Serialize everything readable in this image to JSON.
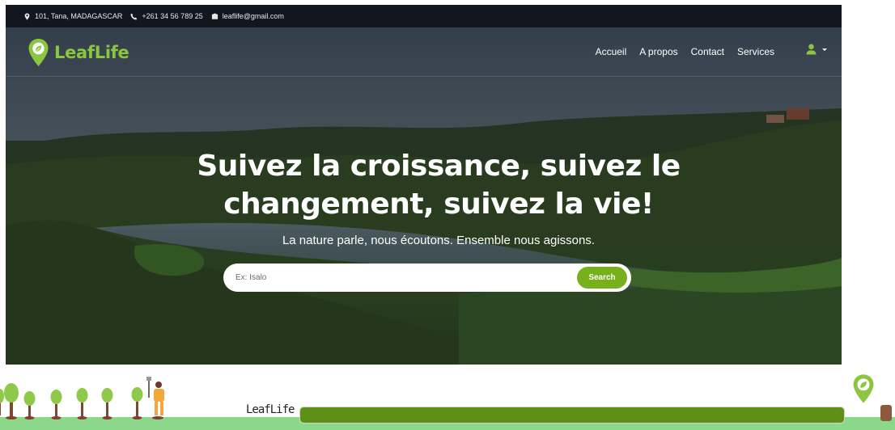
{
  "topbar": {
    "address": "101, Tana, MADAGASCAR",
    "phone": "+261 34 56 789 25",
    "email": "leaflife@gmail.com"
  },
  "brand": {
    "name": "LeafLife",
    "color": "#8cc63f"
  },
  "nav": {
    "items": [
      "Accueil",
      "A propos",
      "Contact",
      "Services"
    ]
  },
  "hero": {
    "title_line1": "Suivez la croissance, suivez le",
    "title_line2": "changement, suivez la vie!",
    "subtitle": "La nature parle, nous écoutons. Ensemble nous agissons."
  },
  "search": {
    "placeholder": "Ex: Isalo",
    "value": "",
    "button_label": "Search",
    "button_color": "#78b01c"
  },
  "loader": {
    "label": "LeafLife",
    "progress": 1.0,
    "fill_color": "#5e8f16",
    "grass_color": "#8bd88b"
  },
  "icons": {
    "address": "map-marker-icon",
    "phone": "phone-icon",
    "email": "envelope-icon",
    "logo": "leaf-pin-icon",
    "user": "user-icon"
  }
}
